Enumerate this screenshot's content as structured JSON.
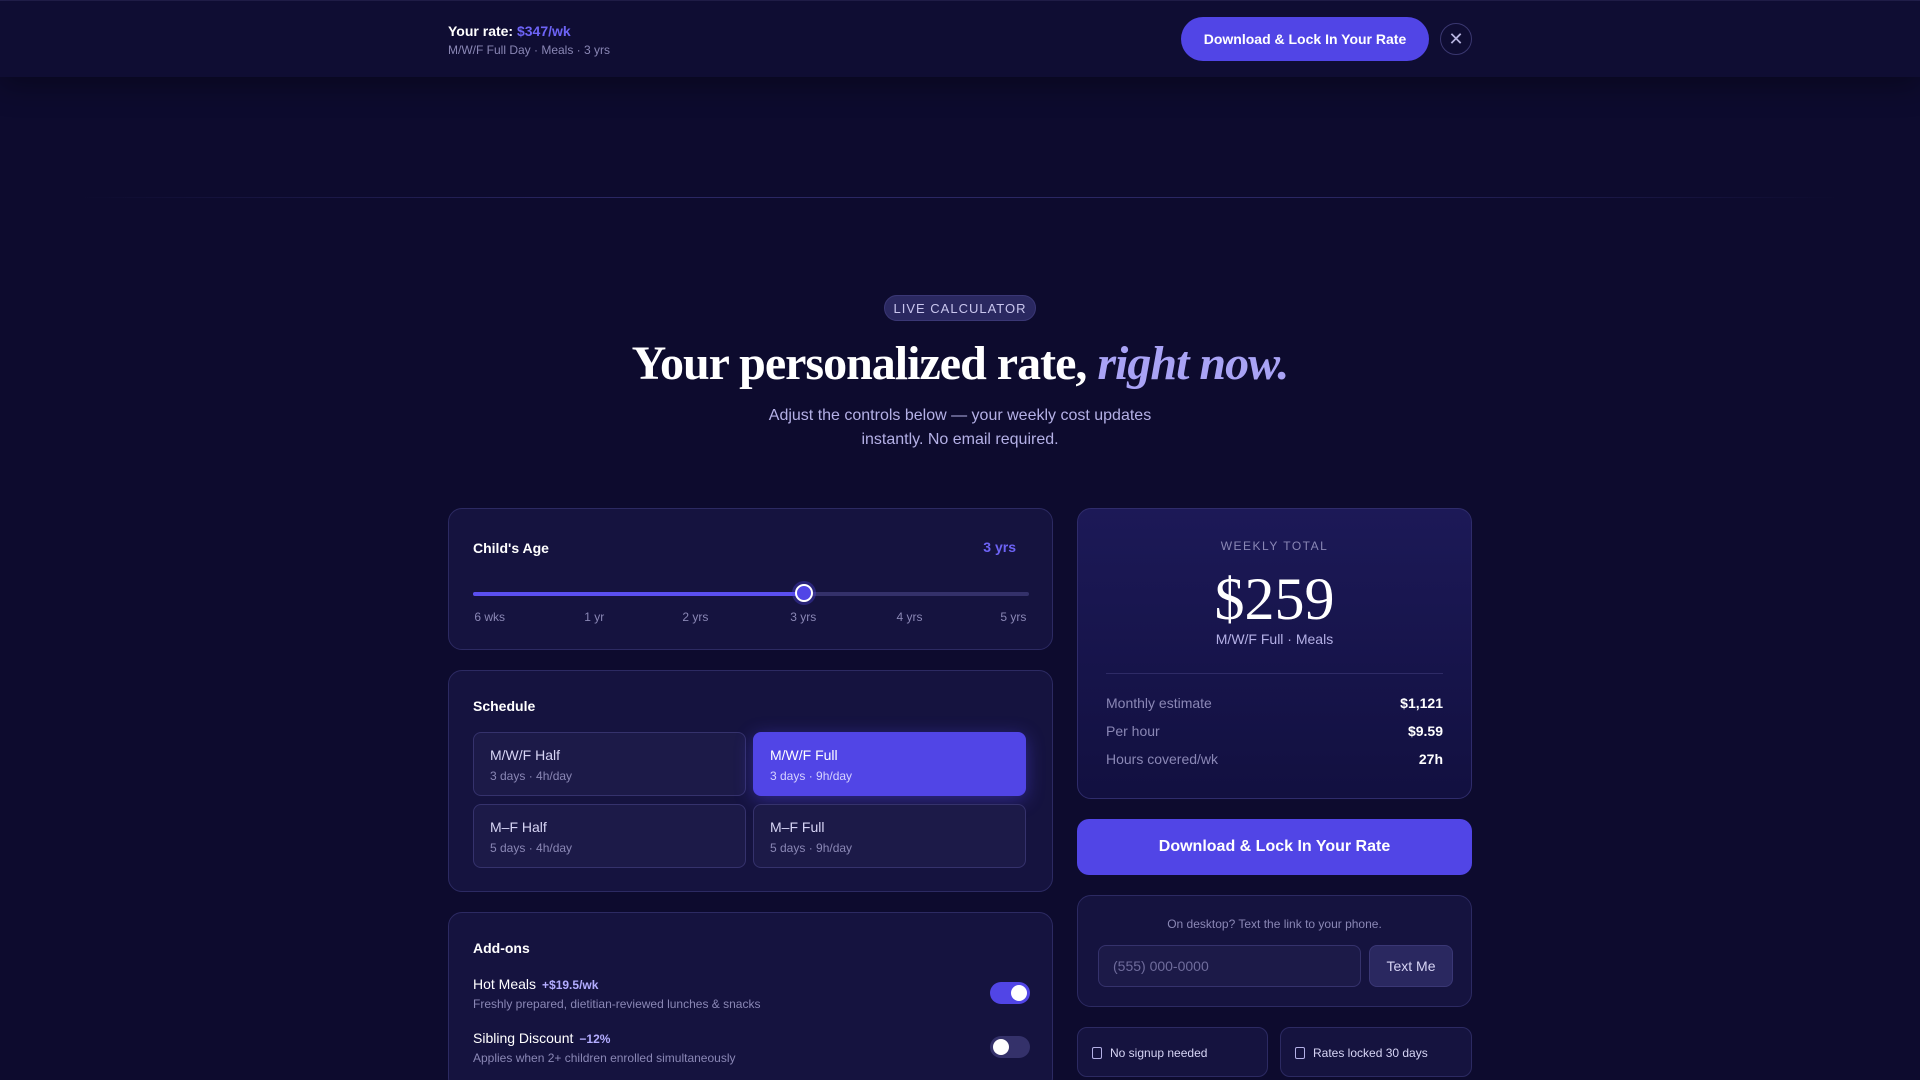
{
  "topbar": {
    "rate_label": "Your rate:",
    "rate_value": "$347/wk",
    "summary": "M/W/F Full Day · Meals · 3 yrs",
    "cta_label": "Download & Lock In Your Rate",
    "close_glyph": "✕"
  },
  "hero": {
    "badge": "LIVE CALCULATOR",
    "headline_main": "Your personalized rate, ",
    "headline_accent": "right now.",
    "subtitle": "Adjust the controls below — your weekly cost updates instantly. No email required."
  },
  "age": {
    "title": "Child's Age",
    "value_label": "3 yrs",
    "slider_fraction": 0.595,
    "ticks": [
      "6 wks",
      "1 yr",
      "2 yrs",
      "3 yrs",
      "4 yrs",
      "5 yrs"
    ]
  },
  "schedule": {
    "title": "Schedule",
    "options": [
      {
        "name": "M/W/F Half",
        "detail": "3 days · 4h/day",
        "selected": false
      },
      {
        "name": "M/W/F Full",
        "detail": "3 days · 9h/day",
        "selected": true
      },
      {
        "name": "M–F Half",
        "detail": "5 days · 4h/day",
        "selected": false
      },
      {
        "name": "M–F Full",
        "detail": "5 days · 9h/day",
        "selected": false
      }
    ]
  },
  "addons": {
    "title": "Add-ons",
    "items": [
      {
        "name": "Hot Meals",
        "price": "+$19.5/wk",
        "desc": "Freshly prepared, dietitian-reviewed lunches & snacks",
        "enabled": true
      },
      {
        "name": "Sibling Discount",
        "price": "−12%",
        "desc": "Applies when 2+ children enrolled simultaneously",
        "enabled": false
      }
    ]
  },
  "total": {
    "label": "WEEKLY TOTAL",
    "amount": "$259",
    "summary": "M/W/F Full · Meals",
    "stats": [
      {
        "label": "Monthly estimate",
        "value": "$1,121"
      },
      {
        "label": "Per hour",
        "value": "$9.59"
      },
      {
        "label": "Hours covered/wk",
        "value": "27h"
      }
    ]
  },
  "cta": {
    "label": "Download & Lock In Your Rate"
  },
  "sms": {
    "note": "On desktop? Text the link to your phone.",
    "placeholder": "(555) 000-0000",
    "button": "Text Me"
  },
  "trust": [
    {
      "label": "No signup needed"
    },
    {
      "label": "Rates locked 30 days"
    }
  ],
  "colors": {
    "background": "#0d0b2e",
    "accent": "#5145e6",
    "accent_text": "#6d63f5",
    "card": "#15133f"
  }
}
